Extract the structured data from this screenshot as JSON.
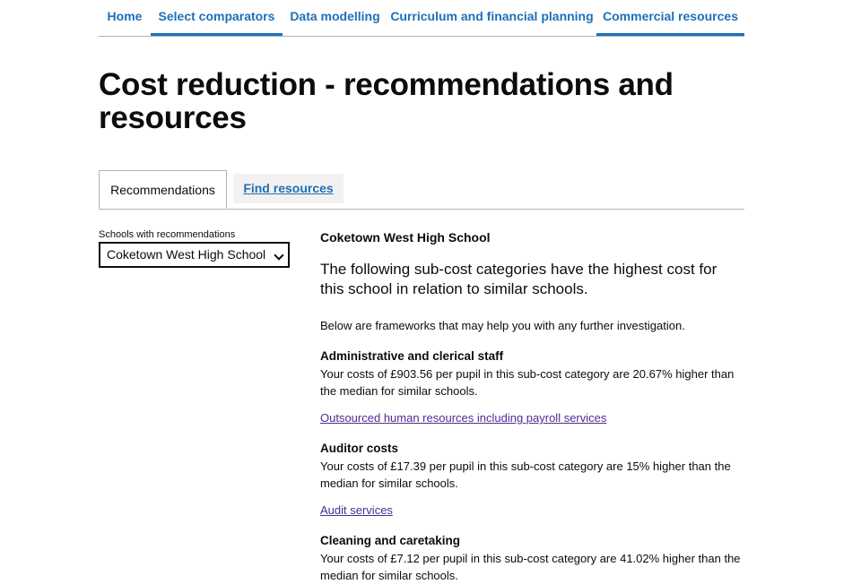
{
  "nav": {
    "items": [
      {
        "label": "Home"
      },
      {
        "label": "Select comparators"
      },
      {
        "label": "Data modelling"
      },
      {
        "label": "Curriculum and financial planning"
      },
      {
        "label": "Commercial resources"
      }
    ]
  },
  "page": {
    "title": "Cost reduction - recommendations and resources"
  },
  "tabs": {
    "recommendations": "Recommendations",
    "find_resources": "Find resources"
  },
  "filter": {
    "label": "Schools with recommendations",
    "selected": "Coketown West High School"
  },
  "main": {
    "school_name": "Coketown West High School",
    "lead": "The following sub-cost categories have the highest cost for this school in relation to similar schools.",
    "intro": "Below are frameworks that may help you with any further investigation.",
    "recommendations": [
      {
        "title": "Administrative and clerical staff",
        "text": "Your costs of £903.56 per pupil in this sub-cost category are 20.67% higher than the median for similar schools.",
        "link": "Outsourced human resources including payroll services"
      },
      {
        "title": "Auditor costs",
        "text": "Your costs of £17.39 per pupil in this sub-cost category are 15% higher than the median for similar schools.",
        "link": "Audit services"
      },
      {
        "title": "Cleaning and caretaking",
        "text": "Your costs of £7.12 per pupil in this sub-cost category are 41.02% higher than the median for similar schools."
      }
    ]
  },
  "colors": {
    "link": "#1d70b8",
    "visited_link": "#4c2c92",
    "text": "#0b0c0c",
    "border": "#b1b4b6"
  }
}
